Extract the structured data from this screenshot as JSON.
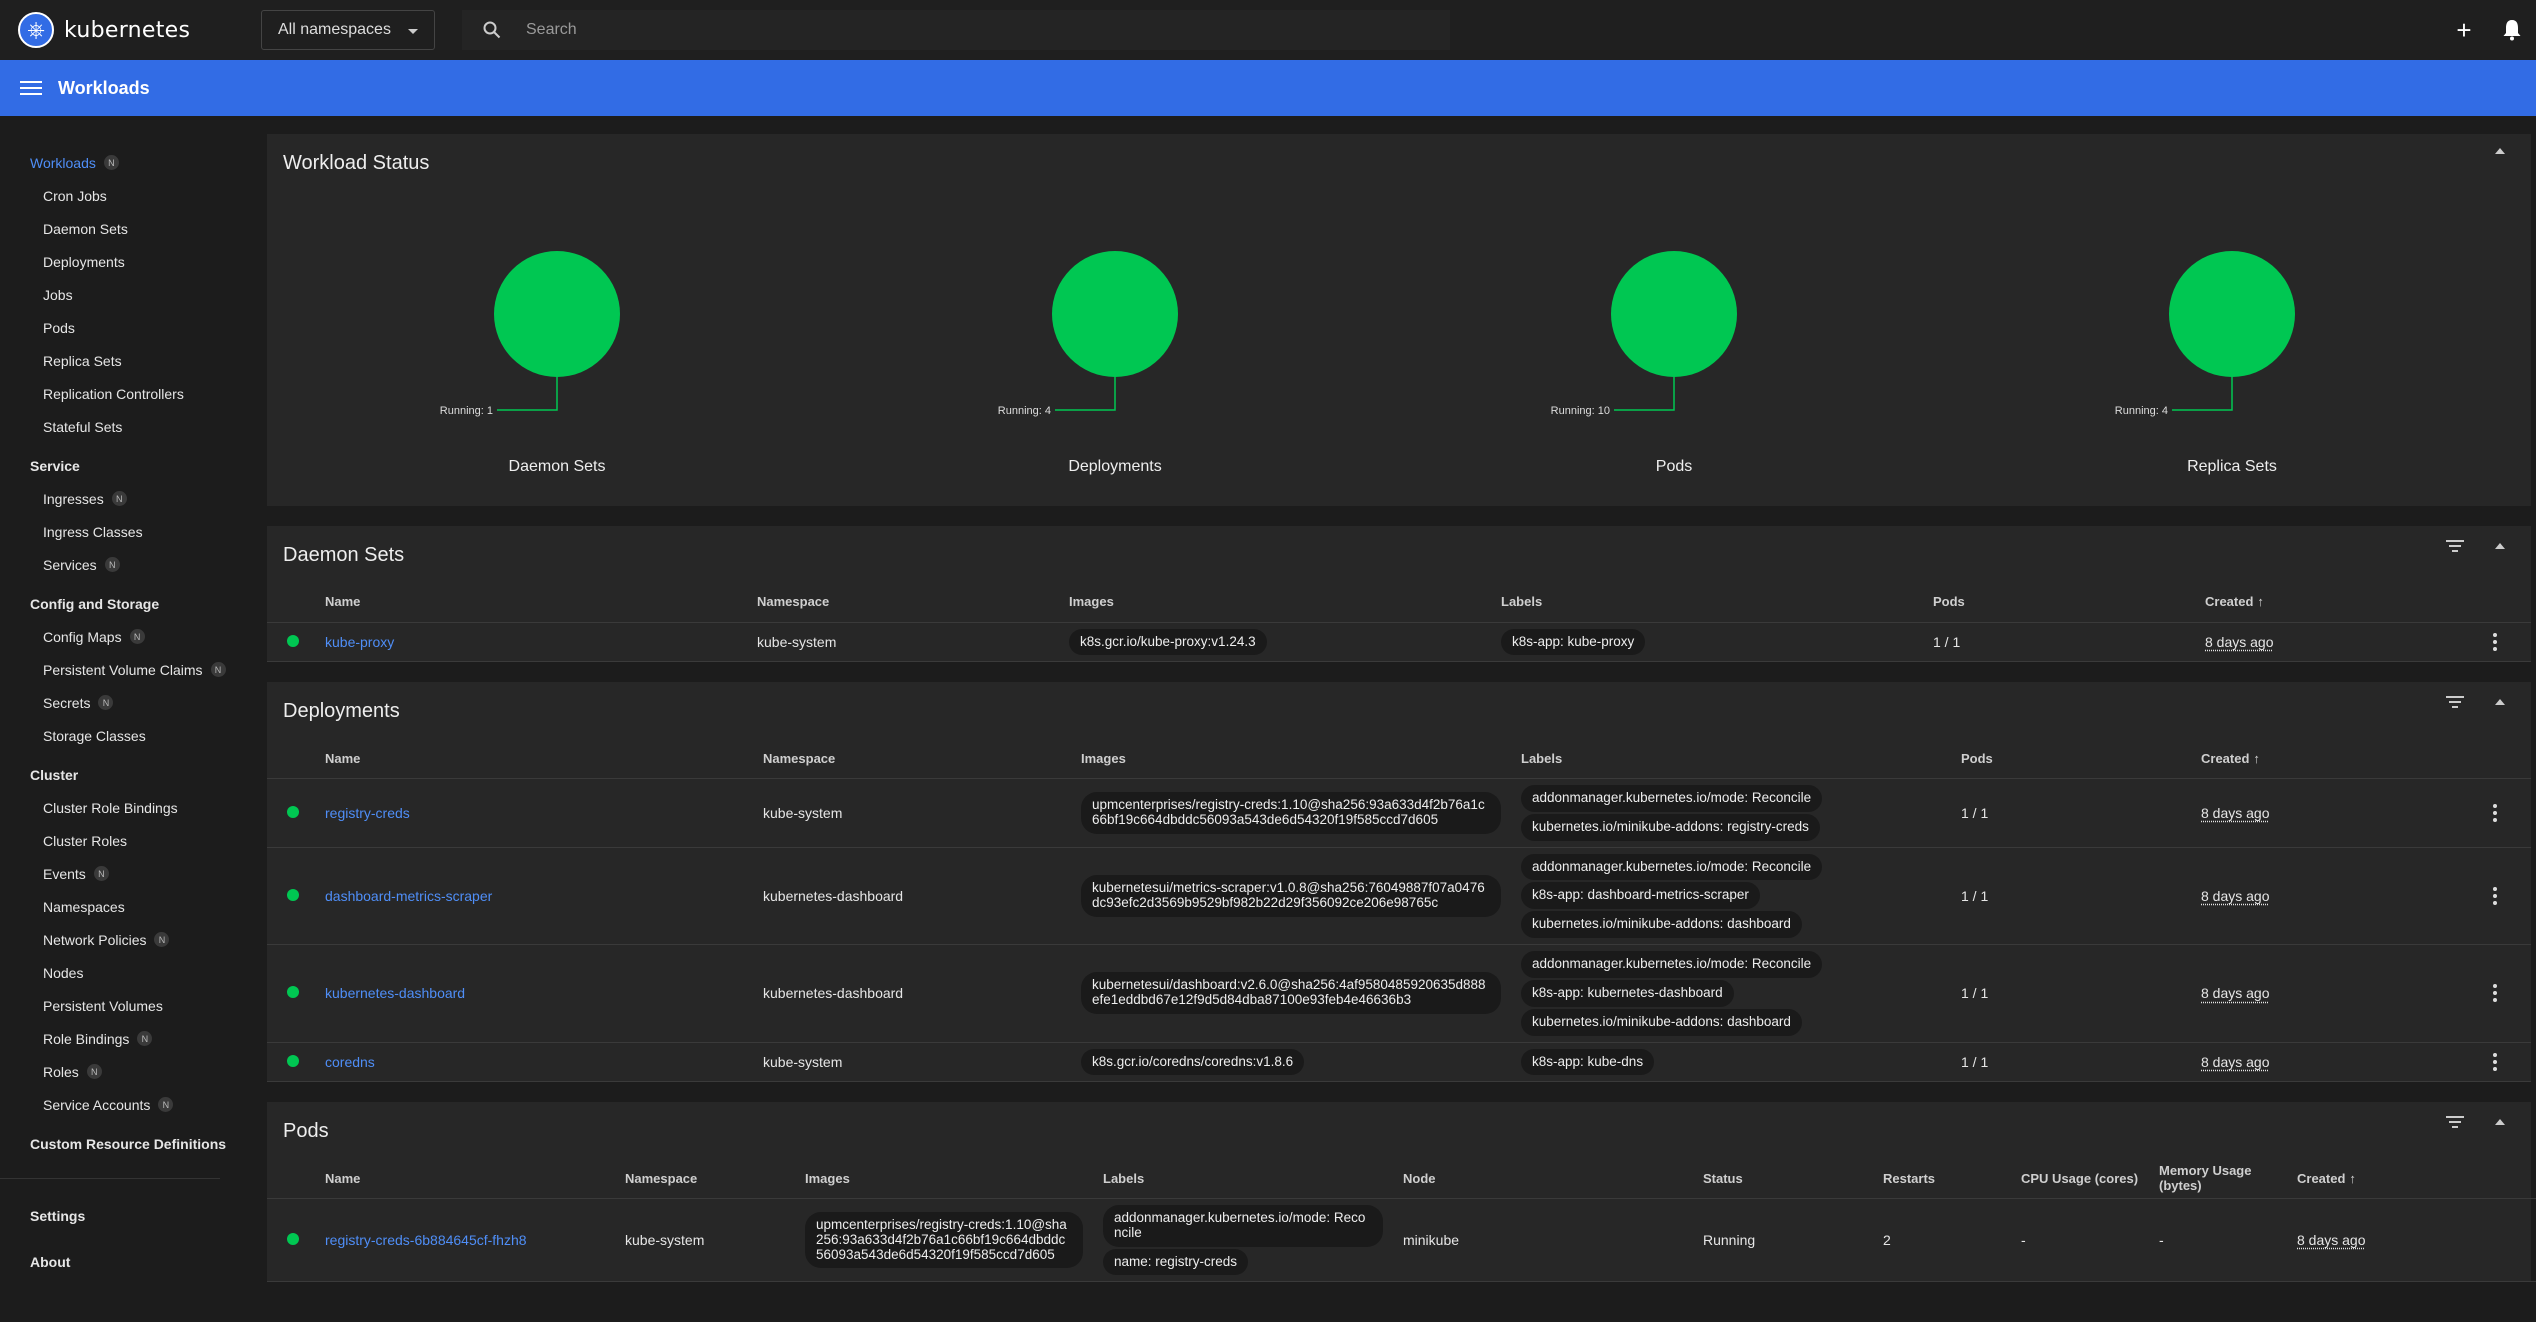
{
  "topbar": {
    "brand": "kubernetes",
    "namespace_select": "All namespaces",
    "search_placeholder": "Search",
    "create_label": "+",
    "notifications_label": "🔔"
  },
  "appbar": {
    "title": "Workloads"
  },
  "sidebar": {
    "groups": [
      {
        "label": "Workloads",
        "badge": "N",
        "active": true,
        "items": [
          {
            "label": "Cron Jobs"
          },
          {
            "label": "Daemon Sets"
          },
          {
            "label": "Deployments"
          },
          {
            "label": "Jobs"
          },
          {
            "label": "Pods"
          },
          {
            "label": "Replica Sets"
          },
          {
            "label": "Replication Controllers"
          },
          {
            "label": "Stateful Sets"
          }
        ]
      },
      {
        "label": "Service",
        "items": [
          {
            "label": "Ingresses",
            "badge": "N"
          },
          {
            "label": "Ingress Classes"
          },
          {
            "label": "Services",
            "badge": "N"
          }
        ]
      },
      {
        "label": "Config and Storage",
        "items": [
          {
            "label": "Config Maps",
            "badge": "N"
          },
          {
            "label": "Persistent Volume Claims",
            "badge": "N"
          },
          {
            "label": "Secrets",
            "badge": "N"
          },
          {
            "label": "Storage Classes"
          }
        ]
      },
      {
        "label": "Cluster",
        "items": [
          {
            "label": "Cluster Role Bindings"
          },
          {
            "label": "Cluster Roles"
          },
          {
            "label": "Events",
            "badge": "N"
          },
          {
            "label": "Namespaces"
          },
          {
            "label": "Network Policies",
            "badge": "N"
          },
          {
            "label": "Nodes"
          },
          {
            "label": "Persistent Volumes"
          },
          {
            "label": "Role Bindings",
            "badge": "N"
          },
          {
            "label": "Roles",
            "badge": "N"
          },
          {
            "label": "Service Accounts",
            "badge": "N"
          }
        ]
      },
      {
        "label": "Custom Resource Definitions",
        "items": []
      }
    ],
    "bottom": [
      "Settings",
      "About"
    ]
  },
  "workload_status": {
    "title": "Workload Status",
    "running_color": "#00c752",
    "charts": [
      {
        "label": "Daemon Sets",
        "running": "Running: 1"
      },
      {
        "label": "Deployments",
        "running": "Running: 4"
      },
      {
        "label": "Pods",
        "running": "Running: 10"
      },
      {
        "label": "Replica Sets",
        "running": "Running: 4"
      }
    ]
  },
  "daemon_sets": {
    "title": "Daemon Sets",
    "columns": [
      "Name",
      "Namespace",
      "Images",
      "Labels",
      "Pods",
      "Created"
    ],
    "rows": [
      {
        "name": "kube-proxy",
        "namespace": "kube-system",
        "images": [
          "k8s.gcr.io/kube-proxy:v1.24.3"
        ],
        "labels": [
          "k8s-app: kube-proxy"
        ],
        "pods": "1 / 1",
        "created": "8 days ago"
      }
    ]
  },
  "deployments": {
    "title": "Deployments",
    "columns": [
      "Name",
      "Namespace",
      "Images",
      "Labels",
      "Pods",
      "Created"
    ],
    "rows": [
      {
        "name": "registry-creds",
        "namespace": "kube-system",
        "images": [
          "upmcenterprises/registry-creds:1.10@sha256:93a633d4f2b76a1c66bf19c664dbddc56093a543de6d54320f19f585ccd7d605"
        ],
        "labels": [
          "addonmanager.kubernetes.io/mode: Reconcile",
          "kubernetes.io/minikube-addons: registry-creds"
        ],
        "pods": "1 / 1",
        "created": "8 days ago"
      },
      {
        "name": "dashboard-metrics-scraper",
        "namespace": "kubernetes-dashboard",
        "images": [
          "kubernetesui/metrics-scraper:v1.0.8@sha256:76049887f07a0476dc93efc2d3569b9529bf982b22d29f356092ce206e98765c"
        ],
        "labels": [
          "addonmanager.kubernetes.io/mode: Reconcile",
          "k8s-app: dashboard-metrics-scraper",
          "kubernetes.io/minikube-addons: dashboard"
        ],
        "pods": "1 / 1",
        "created": "8 days ago"
      },
      {
        "name": "kubernetes-dashboard",
        "namespace": "kubernetes-dashboard",
        "images": [
          "kubernetesui/dashboard:v2.6.0@sha256:4af9580485920635d888efe1eddbd67e12f9d5d84dba87100e93feb4e46636b3"
        ],
        "labels": [
          "addonmanager.kubernetes.io/mode: Reconcile",
          "k8s-app: kubernetes-dashboard",
          "kubernetes.io/minikube-addons: dashboard"
        ],
        "pods": "1 / 1",
        "created": "8 days ago"
      },
      {
        "name": "coredns",
        "namespace": "kube-system",
        "images": [
          "k8s.gcr.io/coredns/coredns:v1.8.6"
        ],
        "labels": [
          "k8s-app: kube-dns"
        ],
        "pods": "1 / 1",
        "created": "8 days ago"
      }
    ]
  },
  "pods": {
    "title": "Pods",
    "columns": [
      "Name",
      "Namespace",
      "Images",
      "Labels",
      "Node",
      "Status",
      "Restarts",
      "CPU Usage (cores)",
      "Memory Usage (bytes)",
      "Created"
    ],
    "rows": [
      {
        "name": "registry-creds-6b884645cf-fhzh8",
        "namespace": "kube-system",
        "images": [
          "upmcenterprises/registry-creds:1.10@sha256:93a633d4f2b76a1c66bf19c664dbddc56093a543de6d54320f19f585ccd7d605"
        ],
        "labels": [
          "addonmanager.kubernetes.io/mode: Reconcile",
          "name: registry-creds"
        ],
        "node": "minikube",
        "status": "Running",
        "restarts": "2",
        "cpu": "-",
        "memory": "-",
        "created": "8 days ago"
      }
    ]
  }
}
